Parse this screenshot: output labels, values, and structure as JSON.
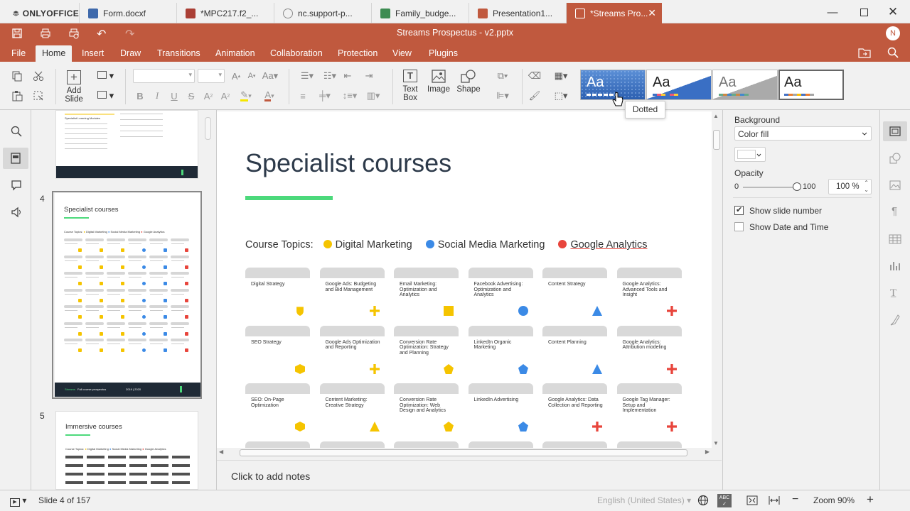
{
  "tabs": [
    {
      "label": "ONLYOFFICE",
      "kind": "app"
    },
    {
      "label": "Form.docxf",
      "color": "#3e69ab"
    },
    {
      "label": "*MPC217.f2_...",
      "color": "#aa3f35"
    },
    {
      "label": "nc.support-p...",
      "color": "#8a8a8a"
    },
    {
      "label": "Family_budge...",
      "color": "#3d8c52"
    },
    {
      "label": "Presentation1...",
      "color": "#c0593e"
    },
    {
      "label": "*Streams Pro...",
      "color": "#ffffff"
    }
  ],
  "title": "Streams Prospectus - v2.pptx",
  "avatar": "N",
  "menu": [
    "File",
    "Home",
    "Insert",
    "Draw",
    "Transitions",
    "Animation",
    "Collaboration",
    "Protection",
    "View",
    "Plugins"
  ],
  "toolbar": {
    "add_slide": "Add Slide",
    "text_box": "Text Box",
    "image": "Image",
    "shape": "Shape",
    "theme_sample": "Aa",
    "tooltip": "Dotted"
  },
  "thumbs": {
    "slide4_number": "4",
    "slide5_number": "5",
    "slide4_title": "Specialist courses",
    "slide5_title": "Immersive courses",
    "footer_brand": "Streams",
    "footer_text": "Full course prospectus",
    "footer_year": "2019 | 2020"
  },
  "slide": {
    "title": "Specialist courses",
    "topics_label": "Course Topics:",
    "legend": [
      {
        "label": "Digital Marketing",
        "color": "#f5c400"
      },
      {
        "label": "Social Media Marketing",
        "color": "#3b8ae6"
      },
      {
        "label": "Google Analytics",
        "color": "#e8453c"
      }
    ],
    "accent": "#4cd97b",
    "cards": [
      [
        "Digital Strategy",
        "Google Ads: Budgeting and Bid Management",
        "Email Marketing: Optimization and Analytics",
        "Facebook Advertising: Optimization and Analytics",
        "Content Strategy",
        "Google Analytics: Advanced Tools and Insight"
      ],
      [
        "SEO Strategy",
        "Google Ads Optimization and Reporting",
        "Conversion Rate Optimization: Strategy and Planning",
        "LinkedIn Organic Marketing",
        "Content Planning",
        "Google Analytics: Attribution modeling"
      ],
      [
        "SEO: On-Page Optimization",
        "Content Marketing: Creative Strategy",
        "Conversion Rate Optimization: Web Design and Analytics",
        "LinkedIn Advertising",
        "Google Analytics: Data Collection and Reporting",
        "Google Tag Manager: Setup and Implementation"
      ]
    ],
    "shapes": [
      [
        "shield",
        "plus",
        "square",
        "circle",
        "triangle",
        "plus"
      ],
      [
        "hexagon",
        "plus",
        "pentagon",
        "pentagon",
        "triangle",
        "plus"
      ],
      [
        "hexagon",
        "triangle",
        "pentagon",
        "pentagon",
        "plus",
        "plus"
      ]
    ]
  },
  "notes_placeholder": "Click to add notes",
  "right_panel": {
    "background_label": "Background",
    "fill_value": "Color fill",
    "opacity_label": "Opacity",
    "opacity_min": "0",
    "opacity_max": "100",
    "opacity_value": "100 %",
    "show_slide_number": "Show slide number",
    "show_slide_number_checked": true,
    "show_date_time": "Show Date and Time",
    "show_date_time_checked": false
  },
  "status": {
    "slide_counter": "Slide 4 of 157",
    "language": "English (United States)",
    "zoom": "Zoom 90%"
  },
  "colors": {
    "accent": "#c0593e",
    "yellow": "#f5c400",
    "blue": "#3b8ae6",
    "red": "#e8453c"
  }
}
